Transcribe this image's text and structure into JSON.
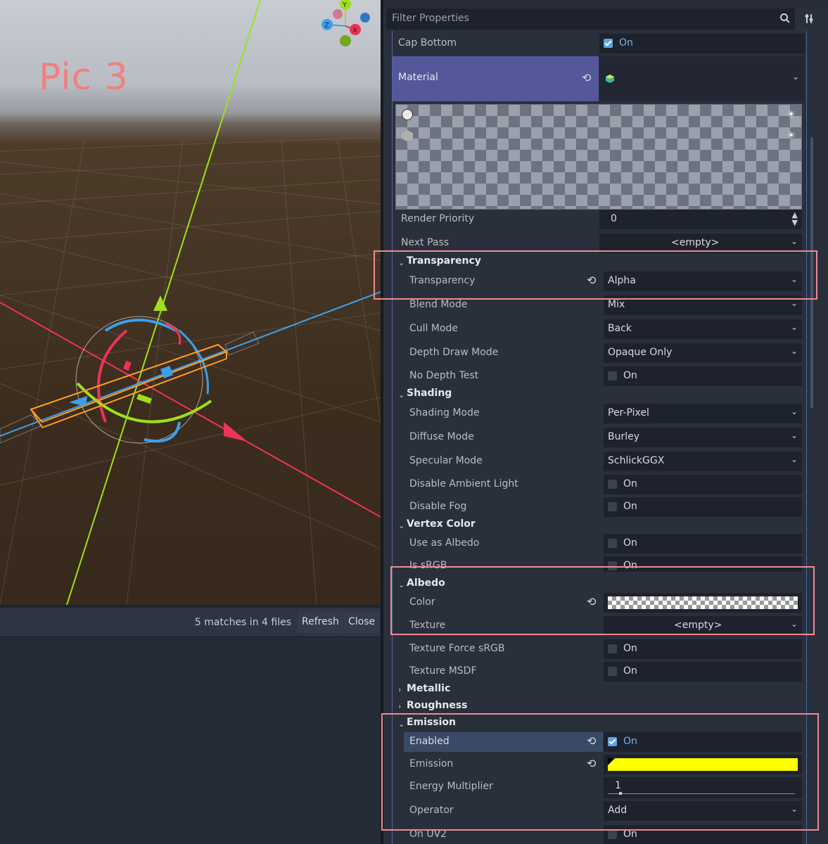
{
  "viewport": {
    "annotation": "Pic 3",
    "gizmo": {
      "x": "X",
      "y": "Y",
      "z": "Z"
    }
  },
  "search_results": {
    "summary": "5 matches in 4 files",
    "refresh_label": "Refresh",
    "close_label": "Close"
  },
  "inspector": {
    "filter_placeholder": "Filter Properties",
    "cap_bottom": {
      "label": "Cap Bottom",
      "value": "On",
      "checked": true
    },
    "material": {
      "label": "Material"
    },
    "render_priority": {
      "label": "Render Priority",
      "value": "0"
    },
    "next_pass": {
      "label": "Next Pass",
      "value": "<empty>"
    },
    "transparency_section": {
      "title": "Transparency",
      "transparency": {
        "label": "Transparency",
        "value": "Alpha"
      },
      "blend_mode": {
        "label": "Blend Mode",
        "value": "Mix"
      },
      "cull_mode": {
        "label": "Cull Mode",
        "value": "Back"
      },
      "depth_draw_mode": {
        "label": "Depth Draw Mode",
        "value": "Opaque Only"
      },
      "no_depth_test": {
        "label": "No Depth Test",
        "value": "On",
        "checked": false
      }
    },
    "shading_section": {
      "title": "Shading",
      "shading_mode": {
        "label": "Shading Mode",
        "value": "Per-Pixel"
      },
      "diffuse_mode": {
        "label": "Diffuse Mode",
        "value": "Burley"
      },
      "specular_mode": {
        "label": "Specular Mode",
        "value": "SchlickGGX"
      },
      "disable_ambient_light": {
        "label": "Disable Ambient Light",
        "value": "On",
        "checked": false
      },
      "disable_fog": {
        "label": "Disable Fog",
        "value": "On",
        "checked": false
      }
    },
    "vertex_color_section": {
      "title": "Vertex Color",
      "use_as_albedo": {
        "label": "Use as Albedo",
        "value": "On",
        "checked": false
      },
      "is_srgb": {
        "label": "Is sRGB",
        "value": "On",
        "checked": false
      }
    },
    "albedo_section": {
      "title": "Albedo",
      "color": {
        "label": "Color"
      },
      "texture": {
        "label": "Texture",
        "value": "<empty>"
      },
      "texture_force_srgb": {
        "label": "Texture Force sRGB",
        "value": "On",
        "checked": false
      },
      "texture_msdf": {
        "label": "Texture MSDF",
        "value": "On",
        "checked": false
      }
    },
    "metallic_section": {
      "title": "Metallic"
    },
    "roughness_section": {
      "title": "Roughness"
    },
    "emission_section": {
      "title": "Emission",
      "enabled": {
        "label": "Enabled",
        "value": "On",
        "checked": true
      },
      "emission": {
        "label": "Emission",
        "color": "#ffff00"
      },
      "energy_multiplier": {
        "label": "Energy Multiplier",
        "value": "1"
      },
      "operator": {
        "label": "Operator",
        "value": "Add"
      },
      "on_uv2": {
        "label": "On UV2",
        "value": "On",
        "checked": false
      }
    }
  },
  "colors": {
    "accent": "#5ea4e6",
    "material_header": "#54589a",
    "highlight_box": "#f08a90",
    "emission_color": "#ffff00"
  }
}
